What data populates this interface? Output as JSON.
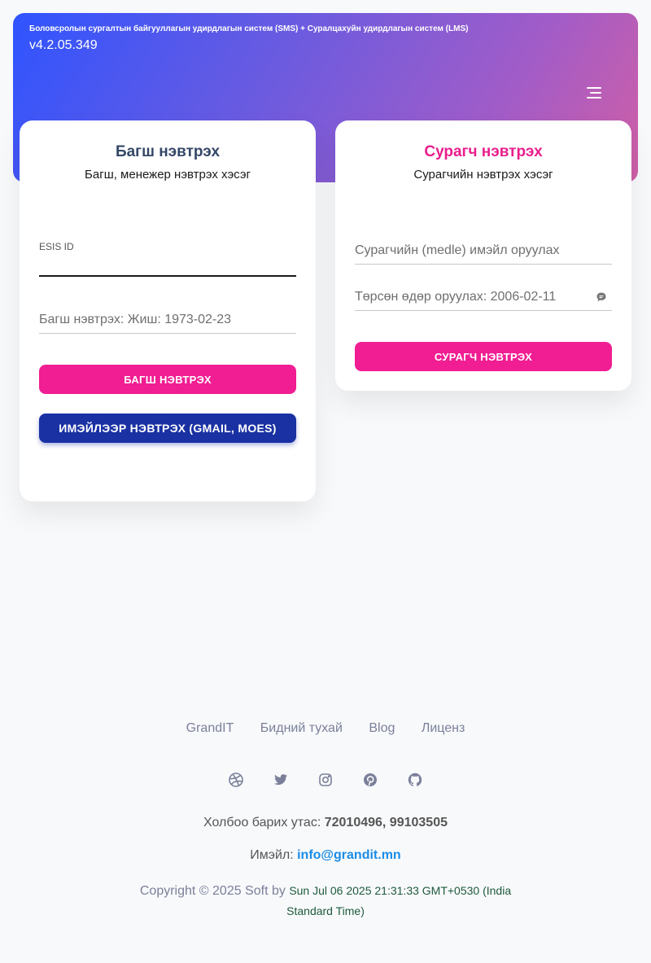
{
  "header": {
    "title": "Боловсролын сургалтын байгууллагын удирдлагын систем (SMS) + Суралцахуйн удирдлагын систем (LMS)",
    "version": "v4.2.05.349",
    "menu_icon": "hamburger-menu-icon"
  },
  "teacher_login": {
    "title": "Багш нэвтрэх",
    "subtitle": "Багш, менежер нэвтрэх хэсэг",
    "esis_label": "ESIS ID",
    "esis_value": "",
    "birthdate_placeholder": "Багш нэвтрэх: Жиш: 1973-02-23",
    "birthdate_value": "",
    "login_button": "БАГШ НЭВТРЭХ",
    "email_button": "ИМЭЙЛЭЭР НЭВТРЭХ (GMAIL, MOES)"
  },
  "student_login": {
    "title": "Сурагч нэвтрэх",
    "subtitle": "Сурагчийн нэвтрэх хэсэг",
    "email_placeholder": "Сурагчийн (medle) имэйл оруулах",
    "birthdate_placeholder": "Төрсөн өдөр оруулах: 2006-02-11",
    "login_button": "СУРАГЧ НЭВТРЭХ",
    "field_icon": "chat-bubble-icon"
  },
  "footer": {
    "links": [
      "GrandIT",
      "Бидний тухай",
      "Blog",
      "Лиценз"
    ],
    "social_icons": [
      "dribbble-icon",
      "twitter-icon",
      "instagram-icon",
      "pinterest-icon",
      "github-icon"
    ],
    "phone_label": "Холбоо барих утас: ",
    "phone_numbers": "72010496, 99103505",
    "email_label": "Имэйл: ",
    "email": "info@grandit.mn",
    "copyright_text": "Copyright © 2025 Soft by ",
    "timestamp": "Sun Jul 06 2025 21:31:33 GMT+0530 (India Standard Time)"
  },
  "colors": {
    "accent_pink": "#f11d92",
    "navy_button": "#1a31a3",
    "title_dark": "#344767",
    "link_blue": "#1a8ce6"
  }
}
